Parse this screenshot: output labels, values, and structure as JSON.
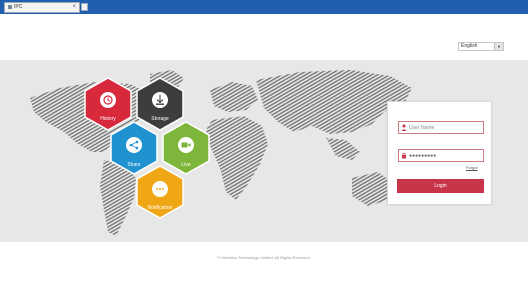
{
  "browser": {
    "tab_title": "IPC",
    "close_glyph": "×"
  },
  "header": {
    "language": "English",
    "dropdown_glyph": "▼"
  },
  "features": [
    {
      "label": "History",
      "color": "#d8283c",
      "icon": "history-icon"
    },
    {
      "label": "Storage",
      "color": "#3d3d3d",
      "icon": "storage-icon"
    },
    {
      "label": "Share",
      "color": "#1f92cf",
      "icon": "share-icon"
    },
    {
      "label": "Live",
      "color": "#7db63a",
      "icon": "live-icon"
    },
    {
      "label": "Notification",
      "color": "#f0a716",
      "icon": "notification-icon"
    }
  ],
  "login": {
    "username_placeholder": "User Name",
    "password_value": "●●●●●●●●●",
    "forgot_label": "Forgot",
    "login_label": "Login",
    "accent_color": "#c8344a"
  },
  "footer": {
    "copyright": "© Hikvision Technology Limited. All Rights Reserved."
  }
}
